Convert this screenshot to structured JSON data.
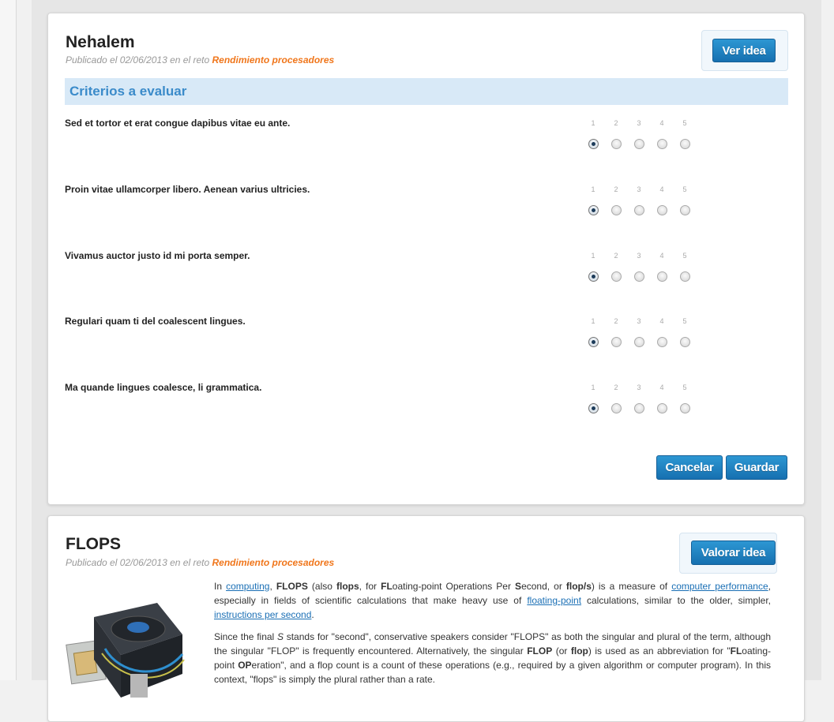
{
  "ideas": [
    {
      "title": "Nehalem",
      "meta_prefix": "Publicado el 02/06/2013 en el reto",
      "meta_reto": "Rendimiento procesadores",
      "action_label": "Ver idea",
      "criteria_heading": "Criterios a evaluar",
      "scale": [
        "1",
        "2",
        "3",
        "4",
        "5"
      ],
      "questions": [
        {
          "text": "Sed et tortor et erat congue dapibus vitae eu ante.",
          "selected": 1
        },
        {
          "text": "Proin vitae ullamcorper libero. Aenean varius ultricies.",
          "selected": 1
        },
        {
          "text": "Vivamus auctor justo id mi porta semper.",
          "selected": 1
        },
        {
          "text": "Regulari quam ti del coalescent lingues.",
          "selected": 1
        },
        {
          "text": "Ma quande lingues coalesce, li grammatica.",
          "selected": 1
        }
      ],
      "cancel_label": "Cancelar",
      "save_label": "Guardar"
    },
    {
      "title": "FLOPS",
      "meta_prefix": "Publicado el 02/06/2013 en el reto",
      "meta_reto": "Rendimiento procesadores",
      "action_label": "Valorar idea",
      "p1": {
        "t1": "In ",
        "l1": "computing",
        "t2": ", ",
        "b1": "FLOPS",
        "t3": " (also ",
        "b2": "flops",
        "t4": ", for ",
        "b3": "FL",
        "t5": "oating-point Operations Per ",
        "b4": "S",
        "t6": "econd, or ",
        "b5": "flop/s",
        "t7": ") is a measure of ",
        "l2": "computer performance",
        "t8": ", especially in fields of scientific calculations that make heavy use of ",
        "l3": "floating-point",
        "t9": " calculations, similar to the older, simpler, ",
        "l4": "instructions per second",
        "t10": "."
      },
      "p2": {
        "t1": "Since the final ",
        "i1": "S",
        "t2": " stands for \"second\", conservative speakers consider \"FLOPS\" as both the singular and plural of the term, although the singular \"FLOP\" is frequently encountered. Alternatively, the singular ",
        "b1": "FLOP",
        "t3": " (or ",
        "b2": "flop",
        "t4": ") is used as an abbreviation for \"",
        "b3": "FL",
        "t5": "oating-point ",
        "b4": "OP",
        "t6": "eration\", and a flop count is a count of these operations (e.g., required by a given algorithm or computer program). In this context, \"flops\" is simply the plural rather than a rate."
      }
    }
  ]
}
